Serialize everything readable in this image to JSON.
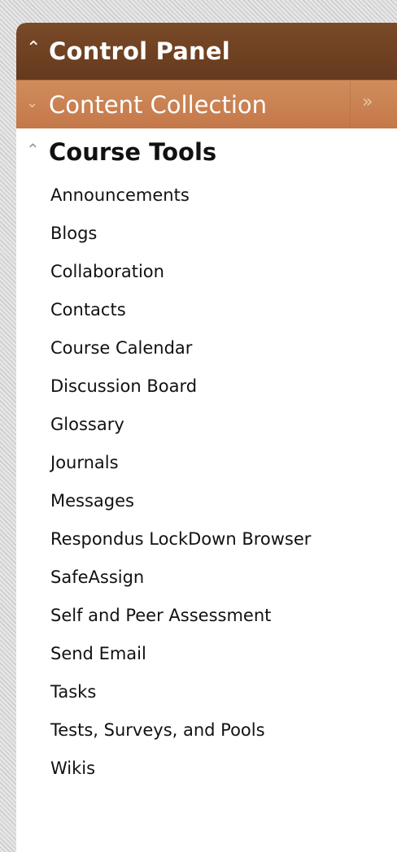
{
  "control_panel": {
    "collapse_icon": "double-chevron-up-icon",
    "title": "Control Panel"
  },
  "content_collection": {
    "expand_icon": "double-chevron-down-icon",
    "title": "Content Collection",
    "open_icon": "double-chevron-right-icon"
  },
  "course_tools": {
    "collapse_icon": "double-chevron-up-icon",
    "title": "Course Tools",
    "items": [
      {
        "label": "Announcements"
      },
      {
        "label": "Blogs"
      },
      {
        "label": "Collaboration"
      },
      {
        "label": "Contacts"
      },
      {
        "label": "Course Calendar"
      },
      {
        "label": "Discussion Board"
      },
      {
        "label": "Glossary"
      },
      {
        "label": "Journals"
      },
      {
        "label": "Messages"
      },
      {
        "label": "Respondus LockDown Browser"
      },
      {
        "label": "SafeAssign"
      },
      {
        "label": "Self and Peer Assessment"
      },
      {
        "label": "Send Email"
      },
      {
        "label": "Tasks"
      },
      {
        "label": "Tests, Surveys, and Pools"
      },
      {
        "label": "Wikis"
      }
    ]
  },
  "colors": {
    "header_brown": "#6f4122",
    "collection_orange": "#c97f50"
  }
}
